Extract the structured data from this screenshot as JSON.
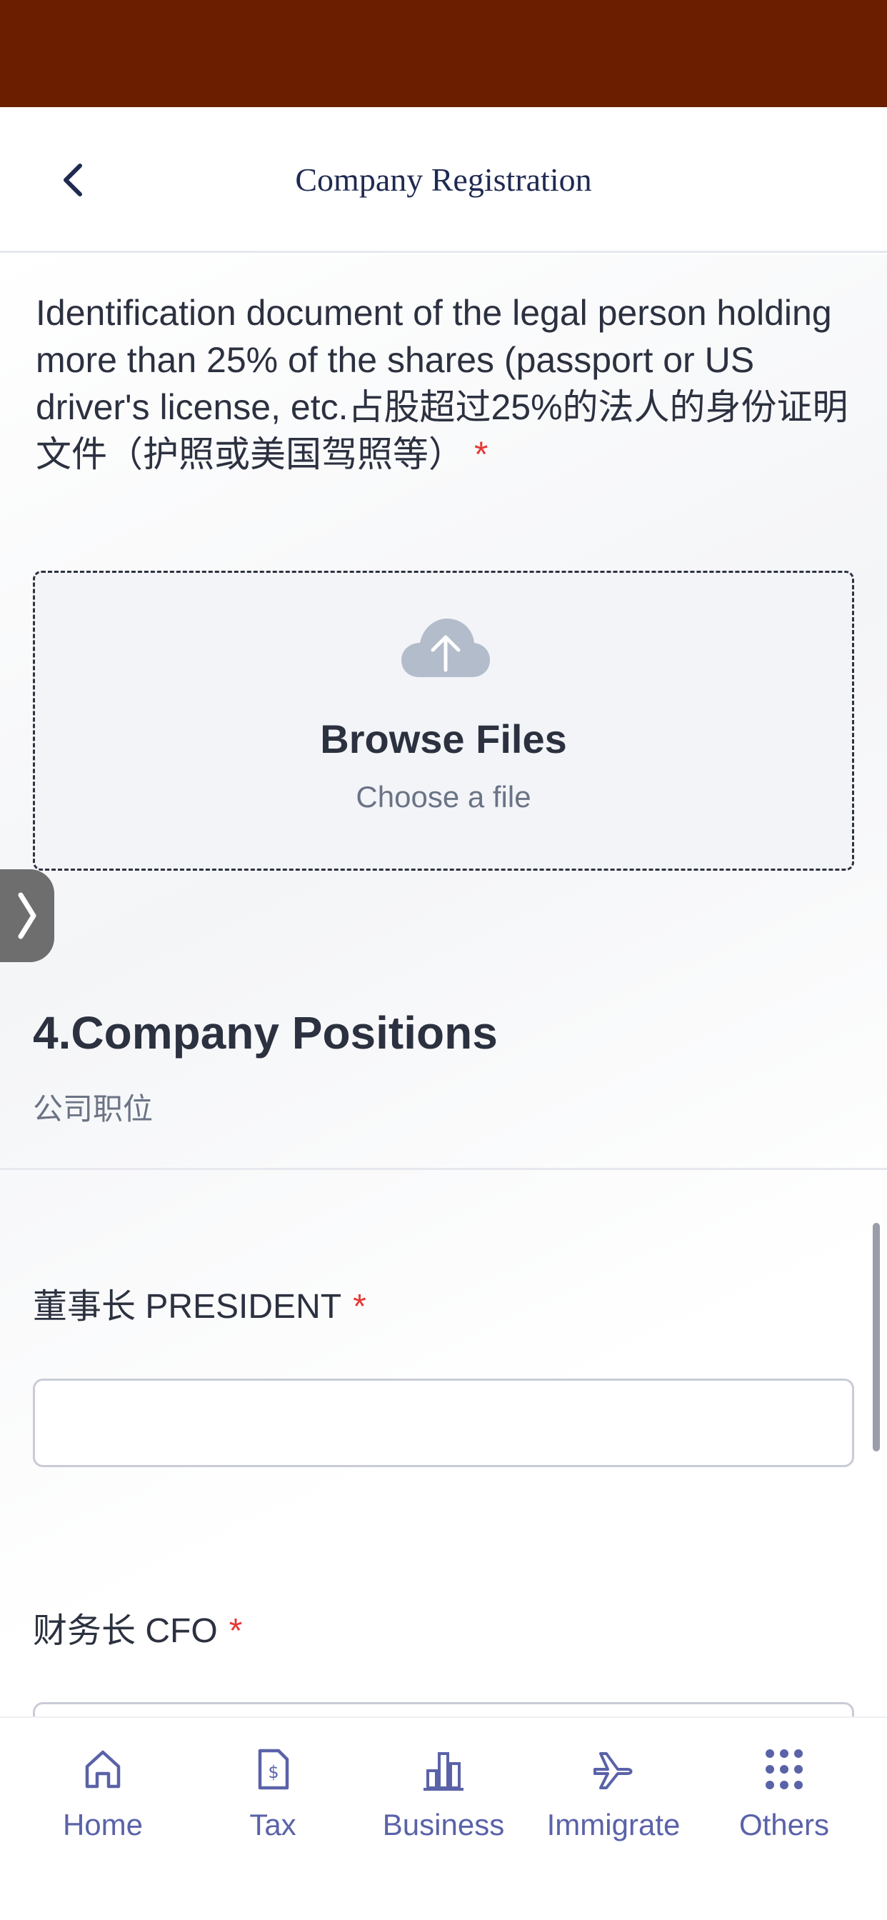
{
  "header": {
    "title": "Company Registration",
    "back_icon": "chevron-left-icon"
  },
  "upload": {
    "label": "Identification document of the legal person holding more than 25% of the shares (passport or US driver's license, etc.占股超过25%的法人的身份证明文件（护照或美国驾照等）",
    "required_mark": "*",
    "icon": "cloud-upload-icon",
    "browse_title": "Browse Files",
    "browse_subtitle": "Choose a file"
  },
  "side_tab": {
    "glyph": "❭"
  },
  "section": {
    "title": "4.Company Positions",
    "subtitle": "公司职位"
  },
  "fields": [
    {
      "label": "董事长 PRESIDENT",
      "required_mark": "*",
      "value": ""
    },
    {
      "label": "财务长 CFO",
      "required_mark": "*",
      "value": ""
    }
  ],
  "tab_bar": {
    "items": [
      {
        "label": "Home",
        "icon": "home-icon"
      },
      {
        "label": "Tax",
        "icon": "tax-document-icon"
      },
      {
        "label": "Business",
        "icon": "bar-chart-icon"
      },
      {
        "label": "Immigrate",
        "icon": "airplane-icon"
      },
      {
        "label": "Others",
        "icon": "grid-dots-icon"
      }
    ]
  },
  "colors": {
    "status_bar": "#6b1f00",
    "accent": "#5a62a8",
    "required": "#e53935",
    "title_text": "#1f2a52"
  }
}
